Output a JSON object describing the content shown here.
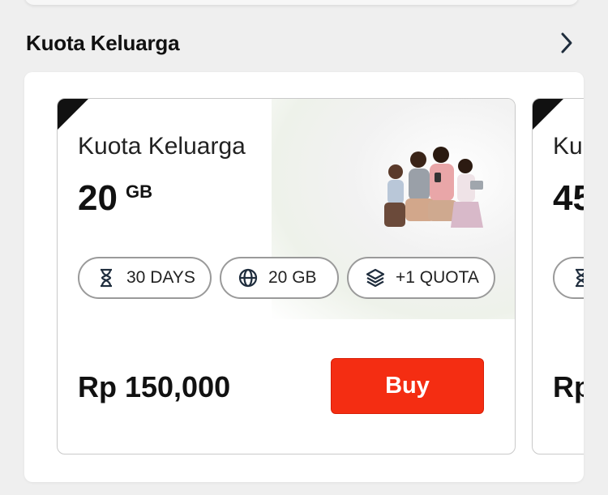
{
  "section": {
    "title": "Kuota Keluarga"
  },
  "cards": [
    {
      "title": "Kuota Keluarga",
      "size_value": "20",
      "size_unit": "GB",
      "chips": [
        {
          "icon": "hourglass-icon",
          "label": "30 DAYS"
        },
        {
          "icon": "globe-icon",
          "label": "20 GB"
        },
        {
          "icon": "layers-icon",
          "label": "+1 QUOTA"
        }
      ],
      "price": "Rp 150,000",
      "buy_label": "Buy",
      "image": "family-photo"
    },
    {
      "title": "Ku",
      "size_value": "45",
      "price": "Rp"
    }
  ],
  "colors": {
    "buy_button": "#f42d12",
    "corner": "#111111",
    "chip_border": "#9a9a9a"
  }
}
